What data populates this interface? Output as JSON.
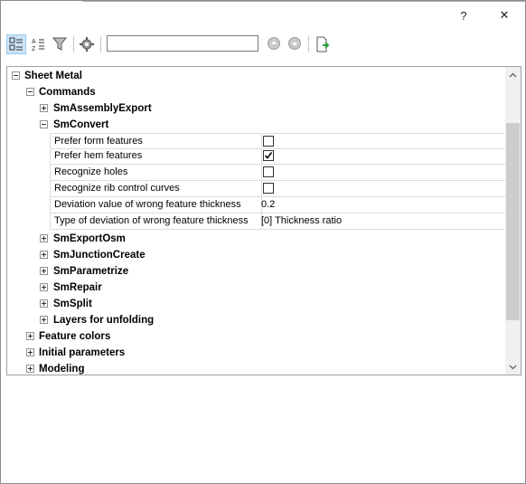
{
  "window": {
    "help_label": "?",
    "close_label": "✕"
  },
  "toolbar": {
    "search_value": "",
    "buttons": [
      "categorized-view-icon",
      "alphabetical-sort-icon",
      "filter-icon",
      "settings-icon",
      "previous-icon",
      "next-icon",
      "export-icon"
    ]
  },
  "tree": {
    "root": "Sheet Metal",
    "commands": "Commands",
    "sm_assembly_export": "SmAssemblyExport",
    "sm_convert": "SmConvert",
    "properties": [
      {
        "name": "Prefer form features",
        "type": "checkbox",
        "checked": false
      },
      {
        "name": "Prefer hem features",
        "type": "checkbox",
        "checked": true
      },
      {
        "name": "Recognize holes",
        "type": "checkbox",
        "checked": false
      },
      {
        "name": "Recognize rib control curves",
        "type": "checkbox",
        "checked": false
      },
      {
        "name": "Deviation value of wrong feature thickness",
        "type": "text",
        "value": "0.2"
      },
      {
        "name": "Type of deviation of wrong feature thickness",
        "type": "text",
        "value": "[0] Thickness ratio"
      }
    ],
    "sm_export_osm": "SmExportOsm",
    "sm_junction_create": "SmJunctionCreate",
    "sm_parametrize": "SmParametrize",
    "sm_repair": "SmRepair",
    "sm_split": "SmSplit",
    "layers_for_unfolding": "Layers for unfolding",
    "feature_colors": "Feature colors",
    "initial_parameters": "Initial parameters",
    "modeling": "Modeling"
  },
  "colors": {
    "accent_active": "#cce4f7",
    "export_green": "#2e9e3a"
  }
}
